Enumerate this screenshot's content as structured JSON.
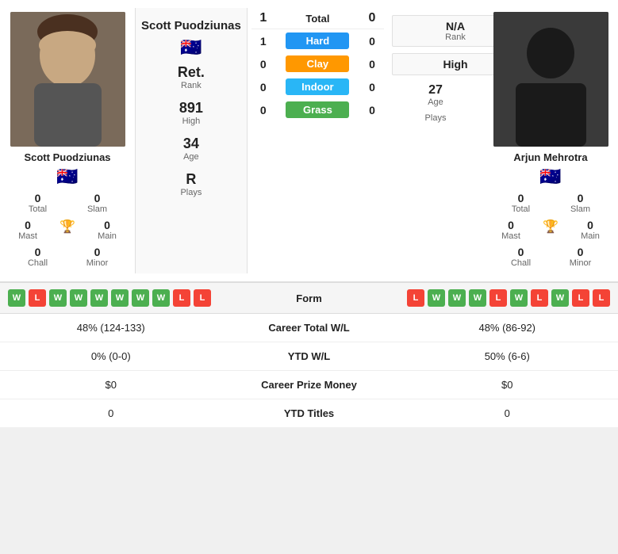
{
  "player_left": {
    "name": "Scott Puodziunas",
    "photo_alt": "Scott Puodziunas photo",
    "flag": "🇦🇺",
    "stats": {
      "total": "0",
      "slam": "0",
      "mast": "0",
      "main": "0",
      "chall": "0",
      "minor": "0"
    },
    "labels": {
      "total": "Total",
      "slam": "Slam",
      "mast": "Mast",
      "main": "Main",
      "chall": "Chall",
      "minor": "Minor"
    }
  },
  "center": {
    "player_left_name": "Scott Puodziunas",
    "player_right_name": "Arjun Mehrotra",
    "rank_label": "Rank",
    "rank_value": "Ret.",
    "high_label": "High",
    "high_value": "891",
    "age_label": "Age",
    "age_value": "34",
    "plays_label": "Plays",
    "plays_value": "R",
    "total_label": "Total",
    "total_left": "1",
    "total_right": "0",
    "hard_left": "1",
    "hard_right": "0",
    "hard_label": "Hard",
    "clay_left": "0",
    "clay_right": "0",
    "clay_label": "Clay",
    "indoor_left": "0",
    "indoor_right": "0",
    "indoor_label": "Indoor",
    "grass_left": "0",
    "grass_right": "0",
    "grass_label": "Grass"
  },
  "player_right": {
    "name": "Arjun Mehrotra",
    "photo_alt": "Arjun Mehrotra photo",
    "flag": "🇦🇺",
    "rank_label": "Rank",
    "rank_value": "N/A",
    "high_label": "High",
    "high_value": "High",
    "age_label": "Age",
    "age_value": "27",
    "plays_label": "Plays",
    "plays_value": "",
    "stats": {
      "total": "0",
      "slam": "0",
      "mast": "0",
      "main": "0",
      "chall": "0",
      "minor": "0"
    },
    "labels": {
      "total": "Total",
      "slam": "Slam",
      "mast": "Mast",
      "main": "Main",
      "chall": "Chall",
      "minor": "Minor"
    }
  },
  "form": {
    "label": "Form",
    "left": [
      "W",
      "L",
      "W",
      "W",
      "W",
      "W",
      "W",
      "W",
      "L",
      "L"
    ],
    "right": [
      "L",
      "W",
      "W",
      "W",
      "L",
      "W",
      "L",
      "W",
      "L",
      "L"
    ]
  },
  "career_stats": {
    "rows": [
      {
        "label": "Career Total W/L",
        "left": "48% (124-133)",
        "right": "48% (86-92)"
      },
      {
        "label": "YTD W/L",
        "left": "0% (0-0)",
        "right": "50% (6-6)"
      },
      {
        "label": "Career Prize Money",
        "left": "$0",
        "right": "$0"
      },
      {
        "label": "YTD Titles",
        "left": "0",
        "right": "0"
      }
    ]
  }
}
